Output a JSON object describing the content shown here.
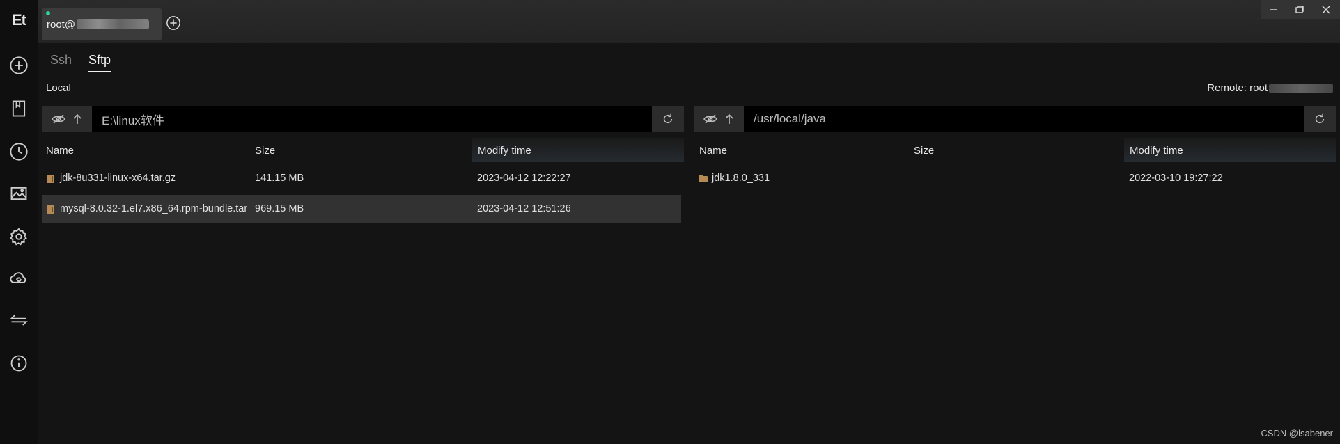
{
  "sidebar": {
    "logo": "Et",
    "icons": [
      "add-icon",
      "bookmark-icon",
      "history-icon",
      "image-icon",
      "gear-icon",
      "cloud-sync-icon",
      "transfer-icon",
      "info-icon"
    ]
  },
  "host_tab": {
    "label": "root@"
  },
  "session_tabs": {
    "ssh": "Ssh",
    "sftp": "Sftp",
    "active": "Sftp"
  },
  "local": {
    "title": "Local",
    "path": "E:\\linux软件",
    "columns": {
      "name": "Name",
      "size": "Size",
      "modified": "Modify time"
    },
    "files": [
      {
        "name": "jdk-8u331-linux-x64.tar.gz",
        "size": "141.15 MB",
        "modified": "2023-04-12 12:22:27",
        "type": "file"
      },
      {
        "name": "mysql-8.0.32-1.el7.x86_64.rpm-bundle.tar",
        "size": "969.15 MB",
        "modified": "2023-04-12 12:51:26",
        "type": "file",
        "selected": true
      }
    ]
  },
  "remote": {
    "title": "Remote: root",
    "path": "/usr/local/java",
    "columns": {
      "name": "Name",
      "size": "Size",
      "modified": "Modify time"
    },
    "files": [
      {
        "name": "jdk1.8.0_331",
        "size": "",
        "modified": "2022-03-10 19:27:22",
        "type": "folder"
      }
    ]
  },
  "watermark": "CSDN @lsabener",
  "colors": {
    "background": "#141414",
    "status_dot": "#2ed3a0",
    "selected_row": "#323232",
    "folder": "#b58a55"
  }
}
